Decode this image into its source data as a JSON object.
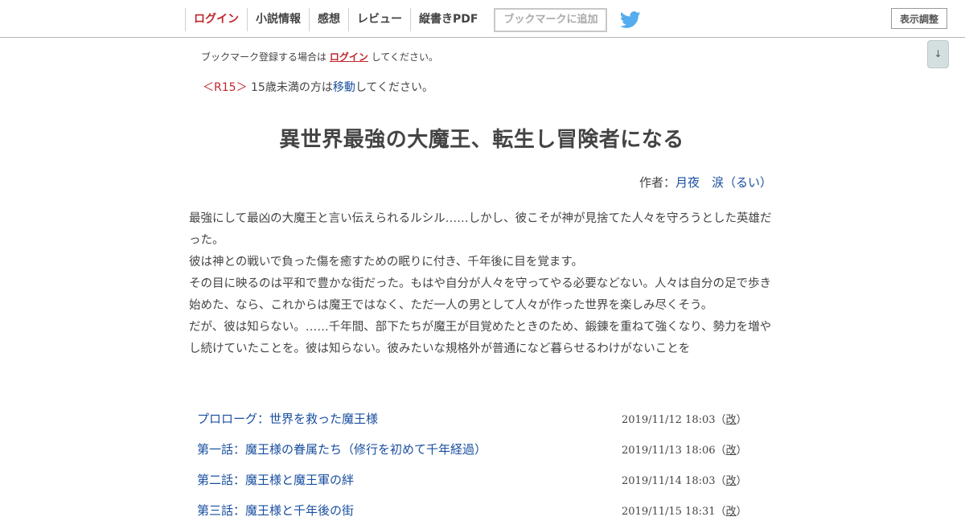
{
  "header": {
    "nav": [
      "ログイン",
      "小説情報",
      "感想",
      "レビュー",
      "縦書きPDF"
    ],
    "bookmark_button": "ブックマークに追加",
    "twitter_icon": "twitter-bird-icon",
    "display_settings": "表示調整",
    "scroll_down": "↓"
  },
  "notice": {
    "prefix": "ブックマーク登録する場合は",
    "login": "ログイン",
    "suffix": "してください。"
  },
  "r15": {
    "tag": "＜R15＞",
    "text": "15歳未満の方は",
    "link": "移動",
    "suffix": "してください。"
  },
  "novel": {
    "title": "異世界最強の大魔王、転生し冒険者になる",
    "author_label": "作者：",
    "author_name": "月夜　涙（るい）",
    "synopsis": [
      "最強にして最凶の大魔王と言い伝えられるルシル……しかし、彼こそが神が見捨てた人々を守ろうとした英雄だった。",
      "彼は神との戦いで負った傷を癒すための眠りに付き、千年後に目を覚ます。",
      "その目に映るのは平和で豊かな街だった。もはや自分が人々を守ってやる必要などない。人々は自分の足で歩き始めた、なら、これからは魔王ではなく、ただ一人の男として人々が作った世界を楽しみ尽くそう。",
      "だが、彼は知らない。……千年間、部下たちが魔王が目覚めたときのため、鍛錬を重ねて強くなり、勢力を増やし続けていたことを。彼は知らない。彼みたいな規格外が普通になど暮らせるわけがないことを"
    ]
  },
  "chapters": [
    {
      "title": "プロローグ：世界を救った魔王様",
      "date": "2019/11/12 18:03",
      "rev": "改"
    },
    {
      "title": "第一話：魔王様の眷属たち（修行を初めて千年経過）",
      "date": "2019/11/13 18:06",
      "rev": "改"
    },
    {
      "title": "第二話：魔王様と魔王軍の絆",
      "date": "2019/11/14 18:03",
      "rev": "改"
    },
    {
      "title": "第三話：魔王様と千年後の街",
      "date": "2019/11/15 18:31",
      "rev": "改"
    }
  ]
}
